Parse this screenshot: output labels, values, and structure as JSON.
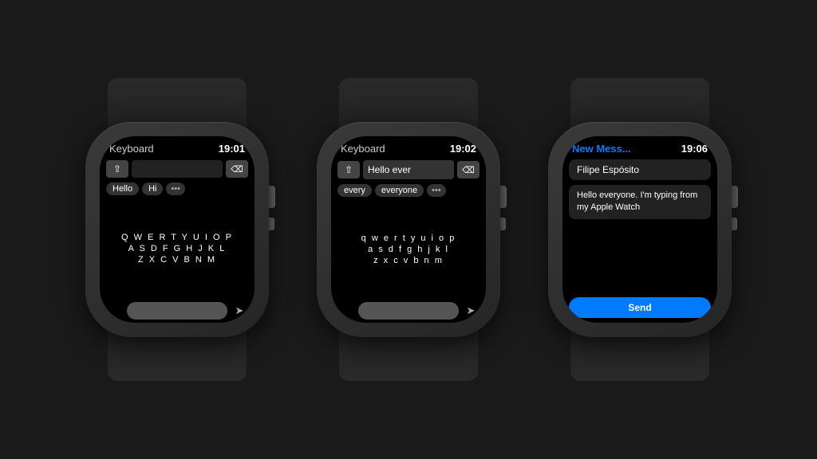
{
  "background": "#1a1a1a",
  "watches": [
    {
      "id": "watch1",
      "screen": "keyboard-empty",
      "header": {
        "title": "Keyboard",
        "time": "19:01"
      },
      "input": {
        "value": ""
      },
      "suggestions": [
        "Hello",
        "Hi",
        "..."
      ],
      "keyboard": {
        "row1": "Q W E R T Y U I O P",
        "row2": "A S D F G H J K L",
        "row3": "Z X C V B N M"
      },
      "bottomBar": {
        "emoji": "☺",
        "space": "",
        "send": "➤"
      }
    },
    {
      "id": "watch2",
      "screen": "keyboard-typing",
      "header": {
        "title": "Keyboard",
        "time": "19:02"
      },
      "input": {
        "value": "Hello ever"
      },
      "suggestions": [
        "every",
        "everyone",
        "..."
      ],
      "keyboard": {
        "row1": "q w e r t y u i o p",
        "row2": "a s d f g h j k l",
        "row3": "z x c v b n m"
      },
      "bottomBar": {
        "emoji": "☺",
        "space": "",
        "send": "➤"
      }
    },
    {
      "id": "watch3",
      "screen": "message-compose",
      "header": {
        "title": "New Mess...",
        "time": "19:06"
      },
      "recipient": "Filipe Espósito",
      "message": "Hello everyone. I'm typing from my Apple Watch",
      "sendButton": "Send"
    }
  ]
}
